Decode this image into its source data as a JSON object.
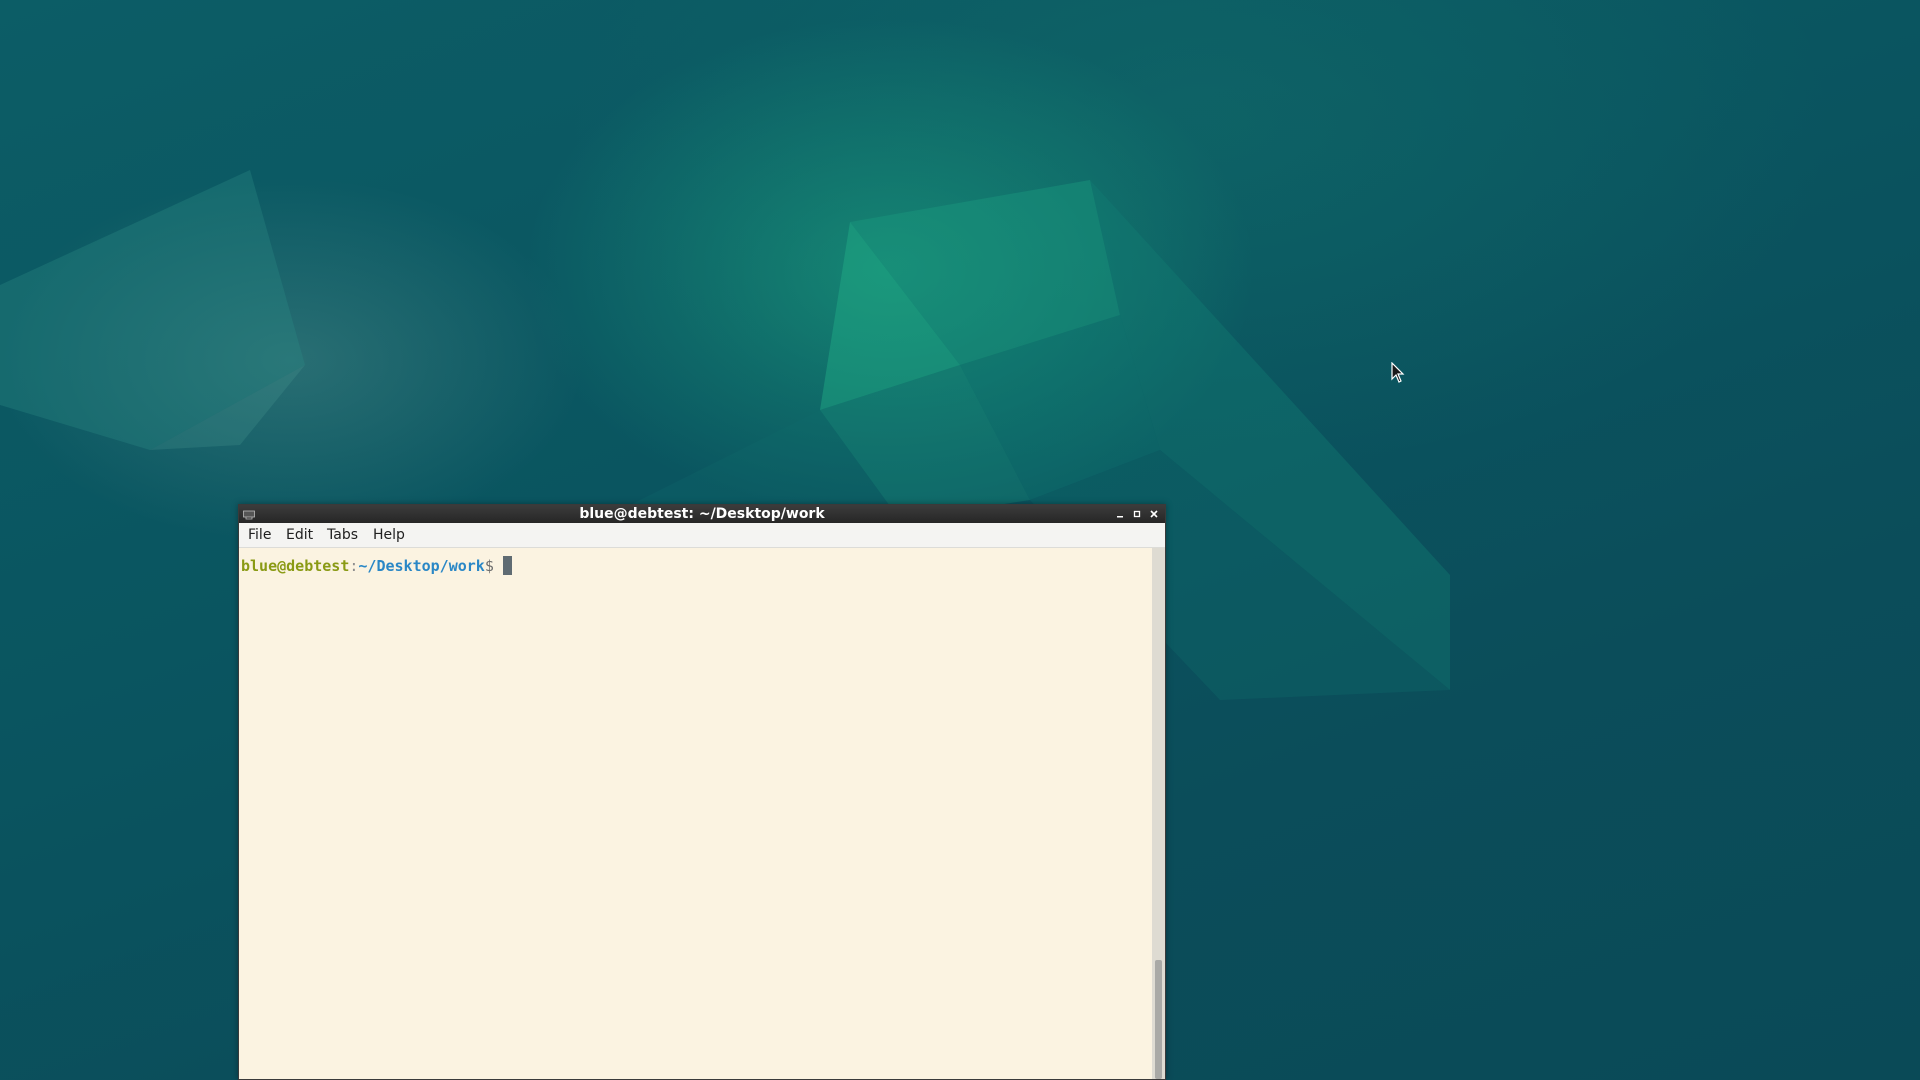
{
  "desktop": {
    "colors": {
      "base": "#0b5560",
      "accent": "#1eaa82"
    }
  },
  "window": {
    "title": "blue@debtest: ~/Desktop/work",
    "icon": "terminal-icon",
    "controls": {
      "minimize": "minimize-icon",
      "maximize": "maximize-icon",
      "close": "close-icon"
    },
    "menu": [
      {
        "label": "File"
      },
      {
        "label": "Edit"
      },
      {
        "label": "Tabs"
      },
      {
        "label": "Help"
      }
    ]
  },
  "terminal": {
    "prompt_user_host": "blue@debtest",
    "prompt_colon": ":",
    "prompt_path": "~/Desktop/work",
    "prompt_symbol": "$",
    "background": "#fbf3e1",
    "user_color": "#8a9a14",
    "path_color": "#2a87c6"
  }
}
